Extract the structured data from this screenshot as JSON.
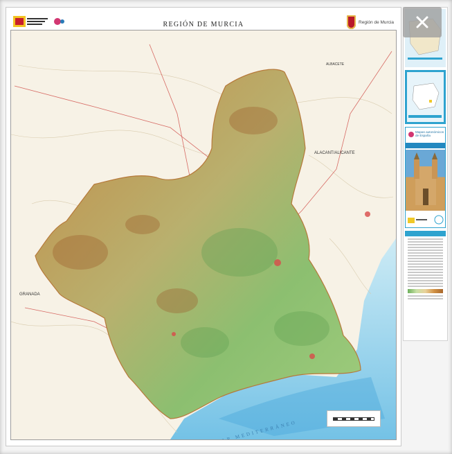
{
  "map": {
    "title": "REGIÓN DE MURCIA",
    "labels": {
      "granada": "GRANADA",
      "alicante": "ALACANT/ALICANTE",
      "albacete": "ALBACETE",
      "sea": "MAR MEDITERRÁNEO"
    }
  },
  "header": {
    "logo_right_text": "Región de Murcia"
  },
  "side_panel": {
    "thumb3_heading": "Mapas autonómicos de España",
    "thumb3_subtitle": "Región de Murcia"
  },
  "controls": {
    "close_icon": "close-icon"
  },
  "colors": {
    "region_green": "#7fb76a",
    "region_brown": "#c38a45",
    "sea": "#8fd0ea",
    "accent_blue": "#2ea3cf"
  }
}
